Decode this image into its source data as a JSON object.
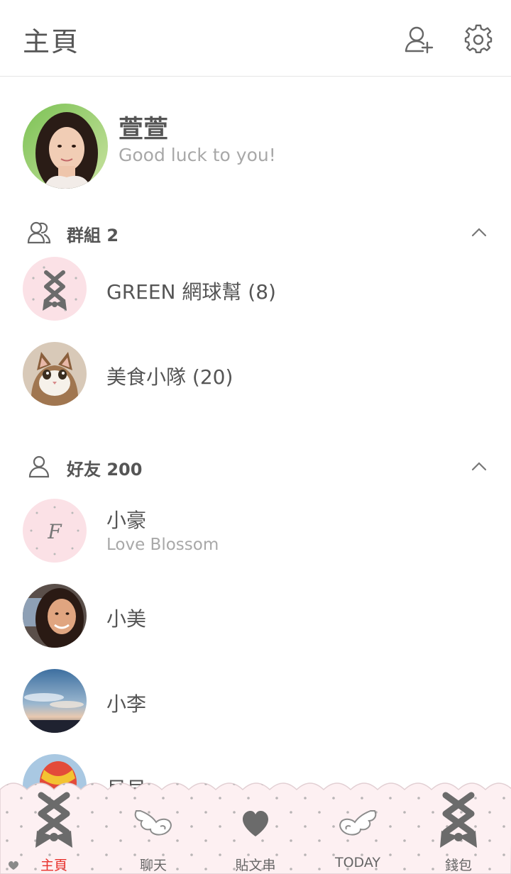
{
  "header": {
    "title": "主頁",
    "add_friend_icon": "add-person-icon",
    "settings_icon": "gear-icon"
  },
  "profile": {
    "name": "萱萱",
    "status": "Good luck to you!"
  },
  "groups_section": {
    "label": "群組",
    "count": "2",
    "items": [
      {
        "name": "GREEN 網球幫 (8)",
        "avatar": "ribbon-lace-icon"
      },
      {
        "name": "美食小隊 (20)",
        "avatar": "cat-photo"
      }
    ]
  },
  "friends_section": {
    "label": "好友",
    "count": "200",
    "items": [
      {
        "name": "小豪",
        "status": "Love Blossom",
        "avatar": "letter-f-icon"
      },
      {
        "name": "小美",
        "avatar": "woman-photo"
      },
      {
        "name": "小李",
        "avatar": "sky-photo"
      },
      {
        "name": "貝貝",
        "avatar": "balloon-photo"
      }
    ]
  },
  "bottom_nav": {
    "items": [
      {
        "label": "主頁",
        "icon": "ribbon-lace-icon",
        "active": true
      },
      {
        "label": "聊天",
        "icon": "wing-icon"
      },
      {
        "label": "貼文串",
        "icon": "heart-icon"
      },
      {
        "label": "TODAY",
        "icon": "wing-icon"
      },
      {
        "label": "錢包",
        "icon": "ribbon-lace-icon"
      }
    ]
  },
  "colors": {
    "accent_active": "#e8302b",
    "nav_background": "#fdf0f2",
    "icon_gray": "#6b6b6b",
    "muted_text": "#a8a8a8"
  }
}
